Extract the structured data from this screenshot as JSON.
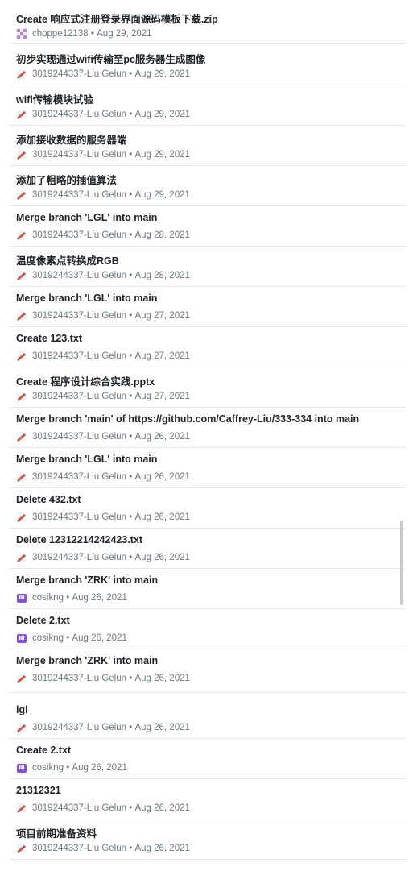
{
  "commits": [
    {
      "message": "Create 响应式注册登录界面源码模板下载.zip",
      "author": "choppe12138",
      "date": "Aug 29, 2021",
      "avatar": "pixel-avatar-icon"
    },
    {
      "message": "初步实现通过wifi传输至pc服务器生成图像",
      "author": "3019244337-Liu Gelun",
      "date": "Aug 29, 2021",
      "avatar": "pen-avatar-icon"
    },
    {
      "message": "wifi传输模块试验",
      "author": "3019244337-Liu Gelun",
      "date": "Aug 29, 2021",
      "avatar": "pen-avatar-icon"
    },
    {
      "message": "添加接收数据的服务器端",
      "author": "3019244337-Liu Gelun",
      "date": "Aug 29, 2021",
      "avatar": "pen-avatar-icon"
    },
    {
      "message": "添加了粗略的插值算法",
      "author": "3019244337-Liu Gelun",
      "date": "Aug 29, 2021",
      "avatar": "pen-avatar-icon"
    },
    {
      "message": "Merge branch 'LGL' into main",
      "author": "3019244337-Liu Gelun",
      "date": "Aug 28, 2021",
      "avatar": "pen-avatar-icon"
    },
    {
      "message": "温度像素点转换成RGB",
      "author": "3019244337-Liu Gelun",
      "date": "Aug 28, 2021",
      "avatar": "pen-avatar-icon"
    },
    {
      "message": "Merge branch 'LGL' into main",
      "author": "3019244337-Liu Gelun",
      "date": "Aug 27, 2021",
      "avatar": "pen-avatar-icon"
    },
    {
      "message": "Create 123.txt",
      "author": "3019244337-Liu Gelun",
      "date": "Aug 27, 2021",
      "avatar": "pen-avatar-icon"
    },
    {
      "message": "Create 程序设计综合实践.pptx",
      "author": "3019244337-Liu Gelun",
      "date": "Aug 27, 2021",
      "avatar": "pen-avatar-icon"
    },
    {
      "message": "Merge branch 'main' of https://github.com/Caffrey-Liu/333-334 into main",
      "author": "3019244337-Liu Gelun",
      "date": "Aug 26, 2021",
      "avatar": "pen-avatar-icon"
    },
    {
      "message": "Merge branch 'LGL' into main",
      "author": "3019244337-Liu Gelun",
      "date": "Aug 26, 2021",
      "avatar": "pen-avatar-icon"
    },
    {
      "message": "Delete 432.txt",
      "author": "3019244337-Liu Gelun",
      "date": "Aug 26, 2021",
      "avatar": "pen-avatar-icon"
    },
    {
      "message": "Delete 12312214242423.txt",
      "author": "3019244337-Liu Gelun",
      "date": "Aug 26, 2021",
      "avatar": "pen-avatar-icon"
    },
    {
      "message": "Merge branch 'ZRK' into main",
      "author": "cosikng",
      "date": "Aug 26, 2021",
      "avatar": "purple-avatar-icon"
    },
    {
      "message": "Delete 2.txt",
      "author": "cosikng",
      "date": "Aug 26, 2021",
      "avatar": "purple-avatar-icon"
    },
    {
      "message": "Merge branch 'ZRK' into main",
      "author": "3019244337-Liu Gelun",
      "date": "Aug 26, 2021",
      "avatar": "pen-avatar-icon"
    },
    {
      "message": "lgl",
      "author": "3019244337-Liu Gelun",
      "date": "Aug 26, 2021",
      "avatar": "pen-avatar-icon"
    },
    {
      "message": "Create 2.txt",
      "author": "cosikng",
      "date": "Aug 26, 2021",
      "avatar": "purple-avatar-icon"
    },
    {
      "message": "21312321",
      "author": "3019244337-Liu Gelun",
      "date": "Aug 26, 2021",
      "avatar": "pen-avatar-icon"
    },
    {
      "message": "项目前期准备资料",
      "author": "3019244337-Liu Gelun",
      "date": "Aug 26, 2021",
      "avatar": "pen-avatar-icon"
    }
  ],
  "separator": " • ",
  "colors": {
    "text": "#1f2328",
    "muted": "#6e7781",
    "border": "#e4e7ea",
    "avatar_pixel": "#b48ad6",
    "avatar_purple": "#8250df"
  }
}
